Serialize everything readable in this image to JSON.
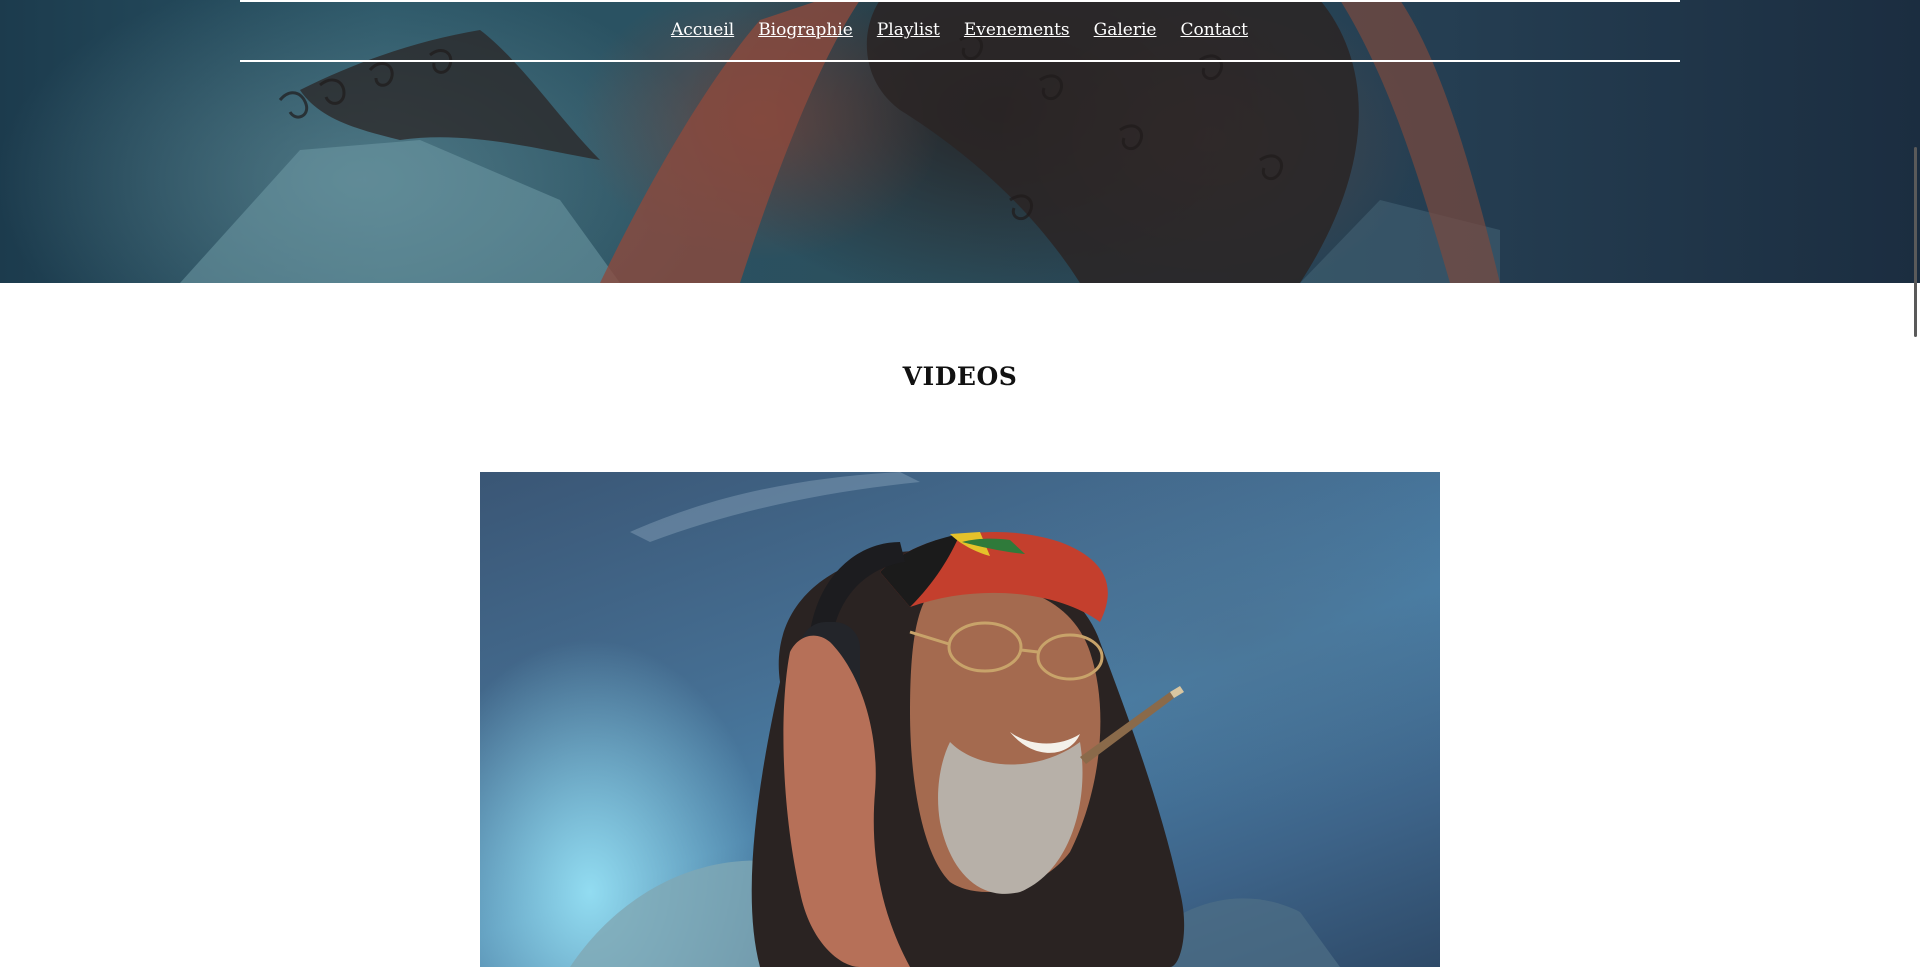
{
  "nav": {
    "items": [
      {
        "label": "Accueil"
      },
      {
        "label": "Biographie"
      },
      {
        "label": "Playlist"
      },
      {
        "label": "Evenements"
      },
      {
        "label": "Galerie"
      },
      {
        "label": "Contact"
      }
    ]
  },
  "videos": {
    "title": "VIDEOS"
  },
  "colors": {
    "nav_text": "#ffffff",
    "title_text": "#111111",
    "hero_base": "#25485a"
  }
}
